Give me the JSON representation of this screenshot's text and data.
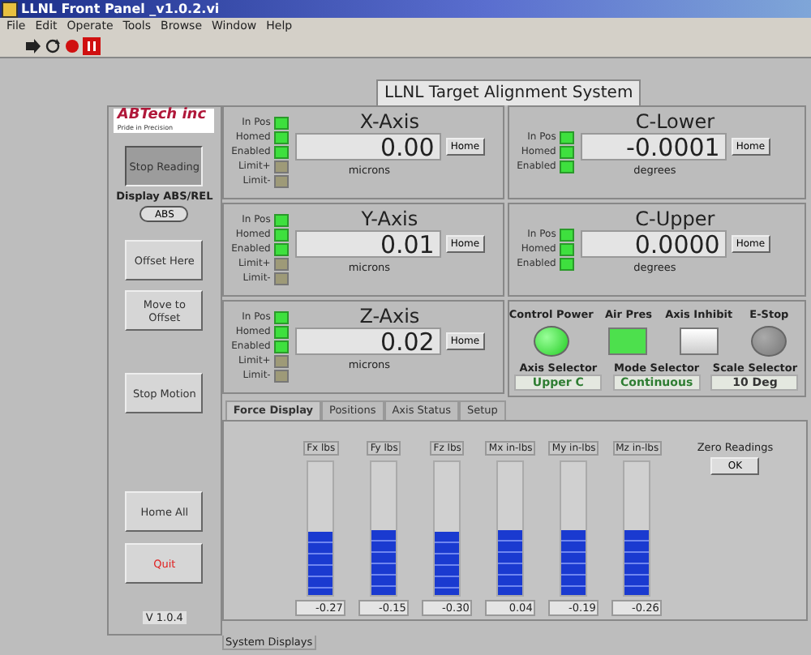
{
  "window": {
    "title": "LLNL Front Panel _v1.0.2.vi"
  },
  "menu": [
    "File",
    "Edit",
    "Operate",
    "Tools",
    "Browse",
    "Window",
    "Help"
  ],
  "panel_title": "LLNL Target Alignment System",
  "logo": {
    "name": "ABTech inc",
    "tagline": "Pride in Precision"
  },
  "left_controls": [
    {
      "kind": "button",
      "label": "Stop Reading",
      "pressed": true
    },
    {
      "kind": "label",
      "label": "Display ABS/REL"
    },
    {
      "kind": "toggle",
      "label": "ABS"
    },
    {
      "kind": "button",
      "label": "Offset Here",
      "pressed": false
    },
    {
      "kind": "button",
      "label": "Move to Offset",
      "pressed": false
    },
    {
      "kind": "button",
      "label": "Stop Motion",
      "pressed": false
    },
    {
      "kind": "button",
      "label": "Home All",
      "pressed": false
    },
    {
      "kind": "danger",
      "label": "Quit",
      "pressed": false
    }
  ],
  "version": "V 1.0.4",
  "axes": [
    {
      "name": "X-Axis",
      "value": "0.00",
      "unit": "microns",
      "home": "Home",
      "leds": [
        {
          "label": "In Pos",
          "on": true
        },
        {
          "label": "Homed",
          "on": true
        },
        {
          "label": "Enabled",
          "on": true
        },
        {
          "label": "Limit+",
          "on": false
        },
        {
          "label": "Limit-",
          "on": false
        }
      ]
    },
    {
      "name": "Y-Axis",
      "value": "0.01",
      "unit": "microns",
      "home": "Home",
      "leds": [
        {
          "label": "In Pos",
          "on": true
        },
        {
          "label": "Homed",
          "on": true
        },
        {
          "label": "Enabled",
          "on": true
        },
        {
          "label": "Limit+",
          "on": false
        },
        {
          "label": "Limit-",
          "on": false
        }
      ]
    },
    {
      "name": "Z-Axis",
      "value": "0.02",
      "unit": "microns",
      "home": "Home",
      "leds": [
        {
          "label": "In Pos",
          "on": true
        },
        {
          "label": "Homed",
          "on": true
        },
        {
          "label": "Enabled",
          "on": true
        },
        {
          "label": "Limit+",
          "on": false
        },
        {
          "label": "Limit-",
          "on": false
        }
      ]
    }
  ],
  "rotations": [
    {
      "name": "C-Lower",
      "value": "-0.0001",
      "unit": "degrees",
      "home": "Home",
      "leds": [
        {
          "label": "In Pos",
          "on": true
        },
        {
          "label": "Homed",
          "on": true
        },
        {
          "label": "Enabled",
          "on": true
        }
      ]
    },
    {
      "name": "C-Upper",
      "value": "0.0000",
      "unit": "degrees",
      "home": "Home",
      "leds": [
        {
          "label": "In Pos",
          "on": true
        },
        {
          "label": "Homed",
          "on": true
        },
        {
          "label": "Enabled",
          "on": true
        }
      ]
    }
  ],
  "status": {
    "indicators": [
      {
        "label": "Control Power",
        "kind": "round",
        "on": true
      },
      {
        "label": "Air Pres",
        "kind": "square",
        "on": true
      },
      {
        "label": "Axis Inhibit",
        "kind": "square",
        "on": false
      },
      {
        "label": "E-Stop",
        "kind": "round",
        "on": false
      }
    ],
    "selectors": [
      {
        "label": "Axis Selector",
        "value": "Upper C",
        "color": "#2e7d32"
      },
      {
        "label": "Mode Selector",
        "value": "Continuous",
        "color": "#2e7d32"
      },
      {
        "label": "Scale Selector",
        "value": "10 Deg",
        "color": "#333333"
      }
    ]
  },
  "tabs": [
    {
      "label": "Force Display",
      "selected": true
    },
    {
      "label": "Positions",
      "selected": false
    },
    {
      "label": "Axis Status",
      "selected": false
    },
    {
      "label": "Setup",
      "selected": false
    }
  ],
  "meters": [
    {
      "label": "Fx lbs",
      "level": 0.48,
      "reading": "-0.27"
    },
    {
      "label": "Fy lbs",
      "level": 0.49,
      "reading": "-0.15"
    },
    {
      "label": "Fz lbs",
      "level": 0.47,
      "reading": "-0.30"
    },
    {
      "label": "Mx in-lbs",
      "level": 0.49,
      "reading": "0.04"
    },
    {
      "label": "My in-lbs",
      "level": 0.49,
      "reading": "-0.19"
    },
    {
      "label": "Mz in-lbs",
      "level": 0.49,
      "reading": "-0.26"
    }
  ],
  "zero": {
    "label": "Zero Readings",
    "button": "OK"
  },
  "footer_tab": "System Displays"
}
